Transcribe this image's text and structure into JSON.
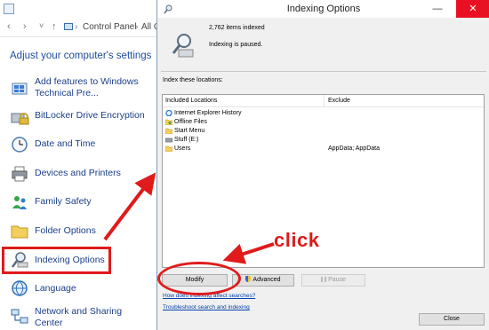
{
  "control_panel": {
    "breadcrumb": {
      "back": "‹",
      "forward": "›",
      "dropdown": "˅",
      "up": "↑",
      "path": [
        "Control Panel",
        "All C"
      ],
      "separator": "›"
    },
    "heading": "Adjust your computer's settings",
    "items": [
      {
        "label": "Add features to Windows Technical Pre...",
        "icon": "windows-features-icon"
      },
      {
        "label": "BitLocker Drive Encryption",
        "icon": "bitlocker-icon"
      },
      {
        "label": "Date and Time",
        "icon": "clock-icon"
      },
      {
        "label": "Devices and Printers",
        "icon": "printer-icon"
      },
      {
        "label": "Family Safety",
        "icon": "family-safety-icon"
      },
      {
        "label": "Folder Options",
        "icon": "folder-icon"
      },
      {
        "label": "Indexing Options",
        "icon": "indexing-icon",
        "highlighted": true
      },
      {
        "label": "Language",
        "icon": "language-icon"
      },
      {
        "label": "Network and Sharing Center",
        "icon": "network-icon"
      }
    ]
  },
  "dialog": {
    "title": "Indexing Options",
    "minimize": "—",
    "close": "✕",
    "items_indexed": "2,762 items indexed",
    "status": "Indexing is paused.",
    "locations_label": "Index these locations:",
    "columns": {
      "included": "Included Locations",
      "exclude": "Exclude"
    },
    "locations": [
      {
        "name": "Internet Explorer History",
        "exclude": "",
        "icon": "ie-icon"
      },
      {
        "name": "Offline Files",
        "exclude": "",
        "icon": "offline-files-icon"
      },
      {
        "name": "Start Menu",
        "exclude": "",
        "icon": "folder-icon"
      },
      {
        "name": "Stuff (E:)",
        "exclude": "",
        "icon": "drive-icon"
      },
      {
        "name": "Users",
        "exclude": "AppData; AppData",
        "icon": "folder-icon"
      }
    ],
    "buttons": {
      "modify": "Modify",
      "advanced": "Advanced",
      "pause": "Pause",
      "close": "Close"
    },
    "links": {
      "affect_searches": "How does indexing affect searches?",
      "troubleshoot": "Troubleshoot search and indexing"
    }
  },
  "annotation": {
    "text": "click",
    "color": "#e01b1b"
  },
  "colors": {
    "link_blue": "#1a3f8a",
    "heading_blue": "#1e4e9c",
    "dialog_bg": "#f0f0f0",
    "close_red": "#e81123"
  }
}
